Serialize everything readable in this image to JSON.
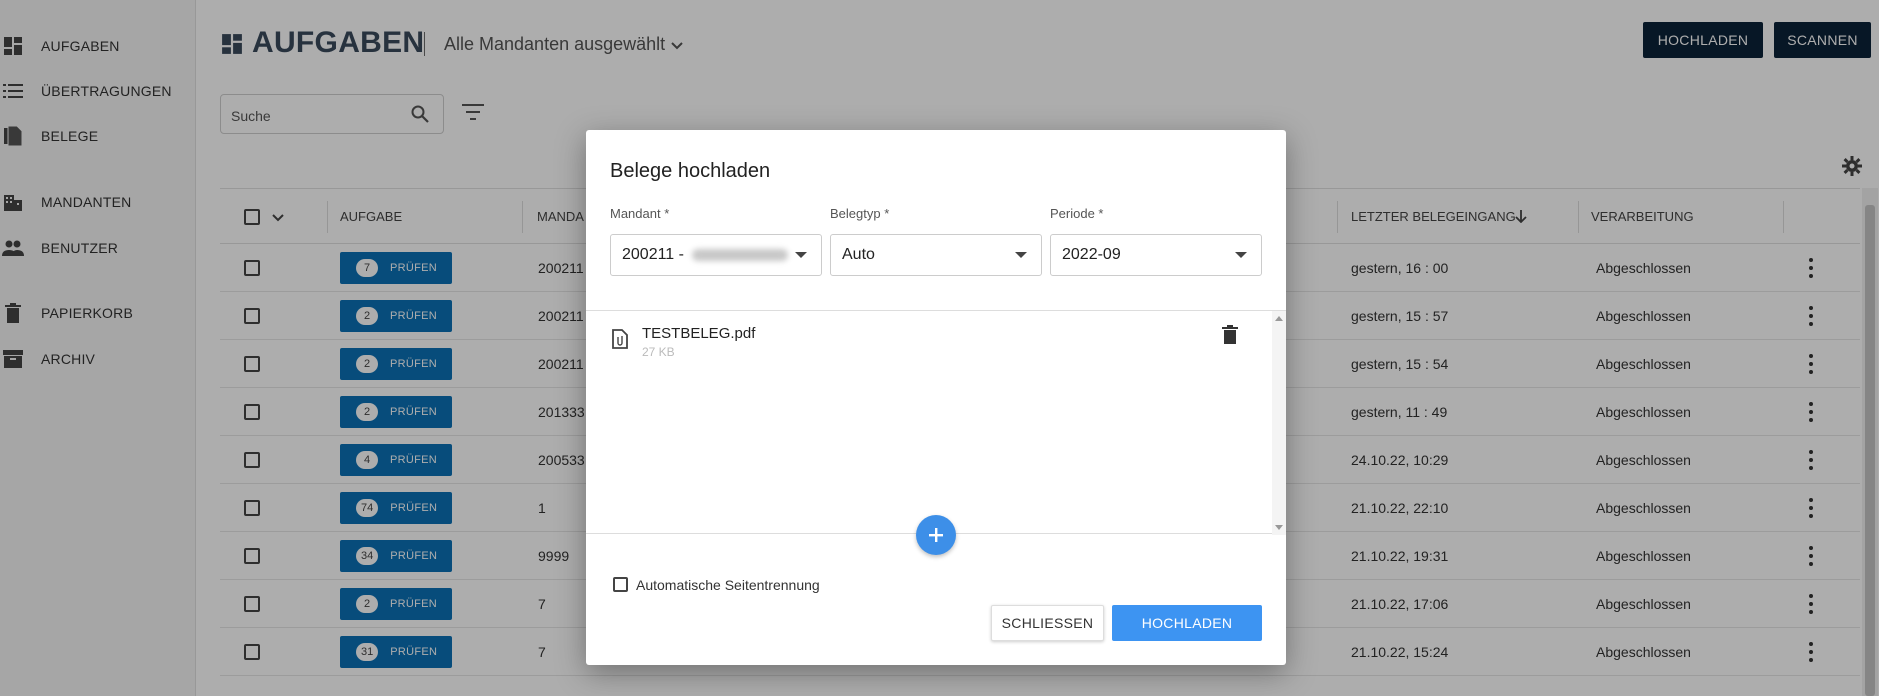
{
  "sidebar": {
    "items": [
      {
        "label": "AUFGABEN",
        "icon": "dashboard-icon"
      },
      {
        "label": "ÜBERTRAGUNGEN",
        "icon": "list-icon"
      },
      {
        "label": "BELEGE",
        "icon": "document-icon"
      },
      {
        "label": "MANDANTEN",
        "icon": "building-icon"
      },
      {
        "label": "BENUTZER",
        "icon": "people-icon"
      },
      {
        "label": "PAPIERKORB",
        "icon": "trash-icon"
      },
      {
        "label": "ARCHIV",
        "icon": "archive-icon"
      }
    ]
  },
  "header": {
    "title": "AUFGABEN",
    "mandant_select": "Alle Mandanten ausgewählt",
    "upload_label": "HOCHLADEN",
    "scan_label": "SCANNEN"
  },
  "search": {
    "placeholder": "Suche"
  },
  "table": {
    "headers": {
      "aufgabe": "AUFGABE",
      "mandant": "MANDA",
      "letzter": "LETZTER BELEGEINGANG",
      "verarbeitung": "VERARBEITUNG"
    },
    "action_label": "PRÜFEN",
    "rows": [
      {
        "count": "7",
        "mandant": "200211",
        "last": "gestern, 16 : 00",
        "status": "Abgeschlossen"
      },
      {
        "count": "2",
        "mandant": "200211",
        "last": "gestern, 15 : 57",
        "status": "Abgeschlossen"
      },
      {
        "count": "2",
        "mandant": "200211",
        "last": "gestern, 15 : 54",
        "status": "Abgeschlossen"
      },
      {
        "count": "2",
        "mandant": "201333",
        "last": "gestern, 11 : 49",
        "status": "Abgeschlossen"
      },
      {
        "count": "4",
        "mandant": "200533",
        "last": "24.10.22, 10:29",
        "status": "Abgeschlossen"
      },
      {
        "count": "74",
        "mandant": "1",
        "last": "21.10.22, 22:10",
        "status": "Abgeschlossen"
      },
      {
        "count": "34",
        "mandant": "9999",
        "last": "21.10.22, 19:31",
        "status": "Abgeschlossen"
      },
      {
        "count": "2",
        "mandant": "7",
        "last": "21.10.22, 17:06",
        "status": "Abgeschlossen"
      },
      {
        "count": "31",
        "mandant": "7",
        "last": "21.10.22, 15:24",
        "status": "Abgeschlossen"
      }
    ]
  },
  "dialog": {
    "title": "Belege hochladen",
    "mandant_label": "Mandant *",
    "mandant_value": "200211 -",
    "belegtyp_label": "Belegtyp *",
    "belegtyp_value": "Auto",
    "periode_label": "Periode *",
    "periode_value": "2022-09",
    "file_name": "TESTBELEG.pdf",
    "file_size": "27 KB",
    "auto_split_label": "Automatische Seitentrennung",
    "close_label": "SCHLIESSEN",
    "upload_label": "HOCHLADEN"
  },
  "colors": {
    "primary_dark": "#0b2238",
    "action_blue": "#0b71b5",
    "upload_blue": "#3d94f2"
  }
}
